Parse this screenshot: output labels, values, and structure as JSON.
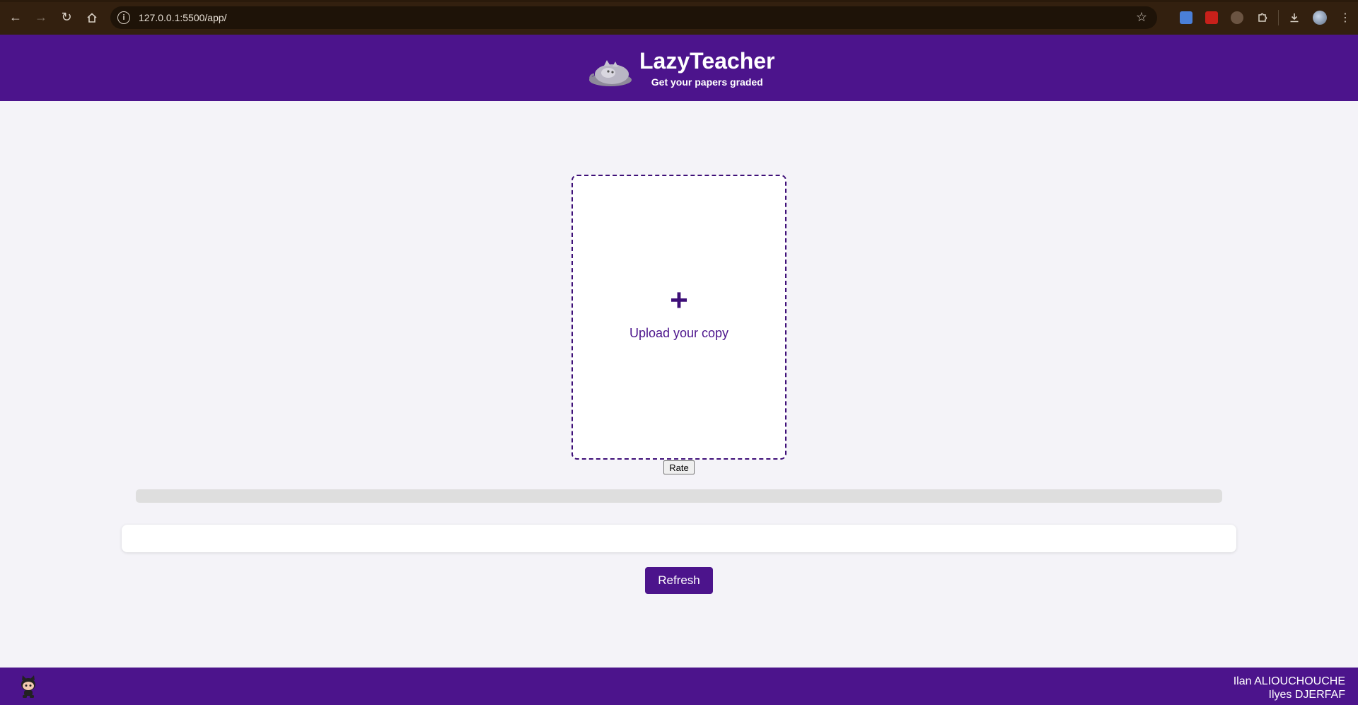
{
  "browser": {
    "url": "127.0.0.1:5500/app/",
    "icons": [
      "back-icon",
      "forward-icon",
      "reload-icon",
      "home-icon",
      "site-info-icon",
      "bookmark-star-icon",
      "translate-extension-icon",
      "pdf-extension-icon",
      "extension-icon",
      "puzzle-extensions-icon",
      "download-icon",
      "profile-avatar",
      "menu-icon"
    ]
  },
  "header": {
    "title": "LazyTeacher",
    "subtitle": "Get your papers graded",
    "logo_icon": "sleeping-cat-logo",
    "background": "#4c148c"
  },
  "upload": {
    "plus": "+",
    "label": "Upload your copy"
  },
  "rate_button": "Rate",
  "progress": {
    "value": 0
  },
  "result": {
    "text": ""
  },
  "refresh_button": "Refresh",
  "footer": {
    "icon": "github-octocat-icon",
    "authors": [
      "Ilan ALIOUCHOUCHE",
      "Ilyes DJERFAF"
    ]
  },
  "colors": {
    "accent": "#4c148c",
    "page_bg": "#f4f3f8"
  }
}
